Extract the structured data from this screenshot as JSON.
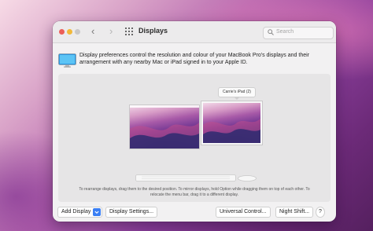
{
  "window": {
    "title": "Displays",
    "search_placeholder": "Search"
  },
  "info": {
    "text": "Display preferences control the resolution and colour of your MacBook Pro's displays and their arrangement with any nearby Mac or iPad signed in to your Apple ID."
  },
  "arrangement": {
    "ipad_label": "Carrie's iPad (2)",
    "hint": "To rearrange displays, drag them to the desired position. To mirror displays, hold Option while dragging them on top of each other. To relocate the menu bar, drag it to a different display."
  },
  "buttons": {
    "add_display": "Add Display",
    "display_settings": "Display Settings...",
    "universal_control": "Universal Control...",
    "night_shift": "Night Shift...",
    "help": "?"
  },
  "icons": {
    "back": "chevron-left-icon",
    "forward": "chevron-right-icon",
    "grid": "show-all-grid-icon",
    "search": "search-icon",
    "monitor": "monitor-icon",
    "keyboard": "keyboard-icon",
    "mouse": "mouse-icon",
    "dropdown": "chevron-down-icon"
  },
  "colors": {
    "accent": "#3b7ff4",
    "close": "#ec5f58",
    "minimize": "#f2b93a"
  }
}
